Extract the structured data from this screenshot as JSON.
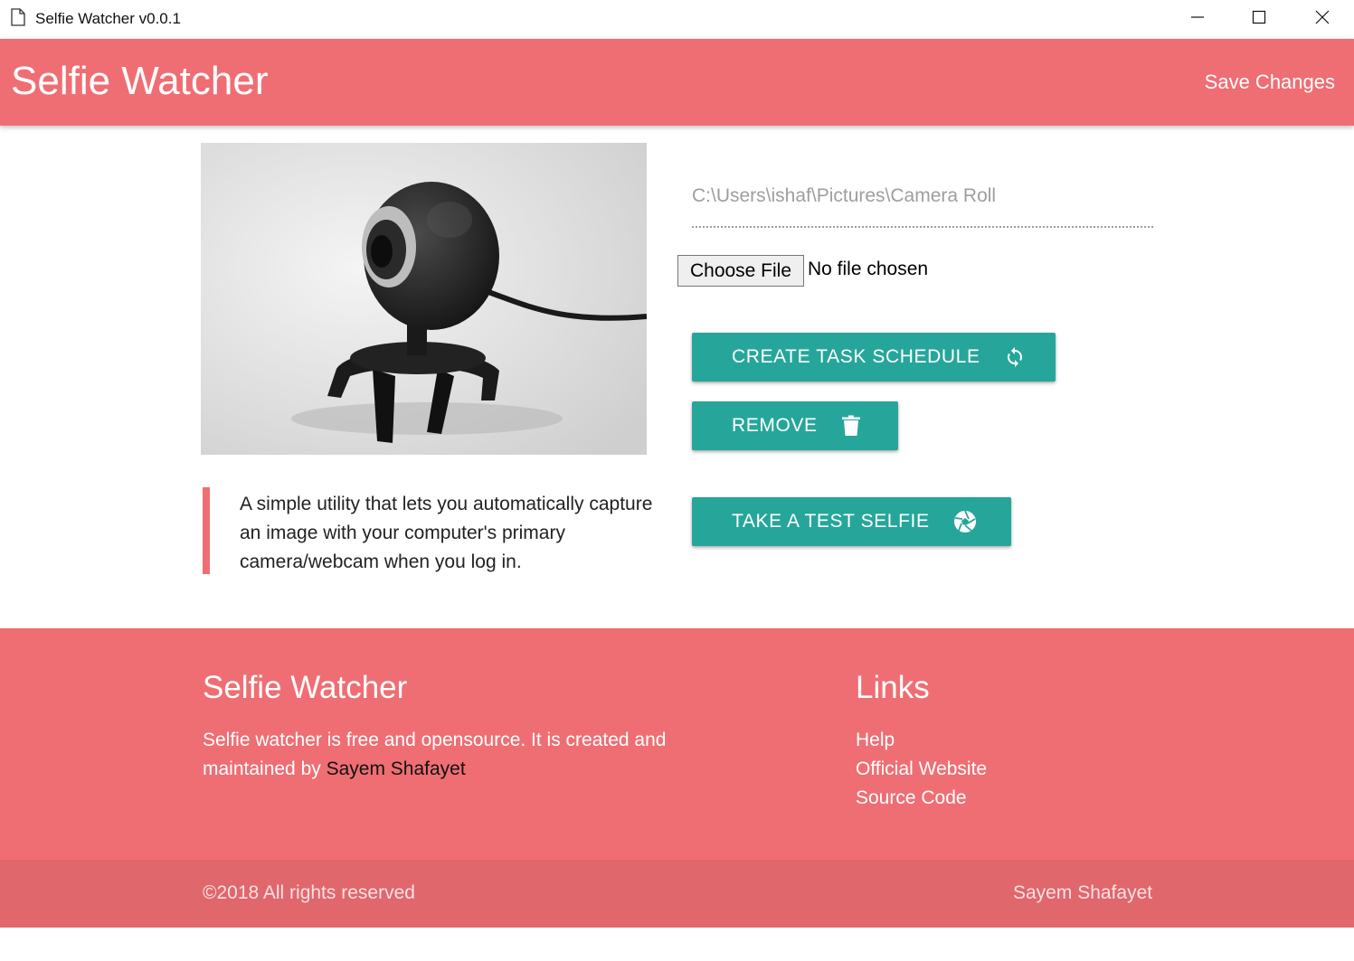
{
  "window": {
    "title": "Selfie Watcher v0.0.1"
  },
  "header": {
    "brand": "Selfie Watcher",
    "save_label": "Save Changes"
  },
  "main": {
    "description": "A simple utility that lets you automatically capture an image with your computer's primary camera/webcam when you log in.",
    "folder_path": "C:\\Users\\ishaf\\Pictures\\Camera Roll",
    "file_button_label": "Choose File",
    "file_status": "No file chosen",
    "buttons": {
      "create": "CREATE TASK SCHEDULE",
      "remove": "REMOVE",
      "test": "TAKE A TEST SELFIE"
    }
  },
  "footer": {
    "title": "Selfie Watcher",
    "text_prefix": "Selfie watcher is free and opensource. It is created and maintained by ",
    "author": "Sayem Shafayet",
    "links_title": "Links",
    "links": [
      "Help",
      "Official Website",
      "Source Code"
    ],
    "copyright": "©2018  All rights reserved",
    "copyright_author": "Sayem Shafayet"
  },
  "colors": {
    "primary": "#ef6e73",
    "accent": "#26a69a",
    "footer_bar": "#e0676c"
  }
}
